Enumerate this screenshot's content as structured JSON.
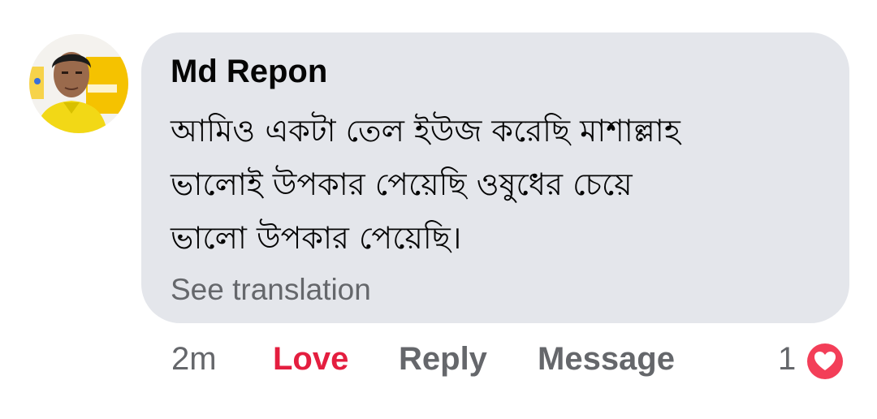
{
  "comment": {
    "author": "Md Repon",
    "lines": [
      "আমিও একটা তেল ইউজ করেছি মাশাল্লাহ",
      "ভালোই উপকার পেয়েছি ওষুধের চেয়ে",
      "ভালো উপকার পেয়েছি।"
    ],
    "see_translation": "See translation",
    "avatar": "profile-photo"
  },
  "actions": {
    "time": "2m",
    "love": "Love",
    "reply": "Reply",
    "message": "Message",
    "reaction_count": "1",
    "reaction_icon": "love-reaction-icon"
  },
  "colors": {
    "bubble": "#e4e6eb",
    "text": "#050505",
    "muted": "#65676b",
    "love": "#e41e3f",
    "reaction_fill": "#f33e58"
  }
}
